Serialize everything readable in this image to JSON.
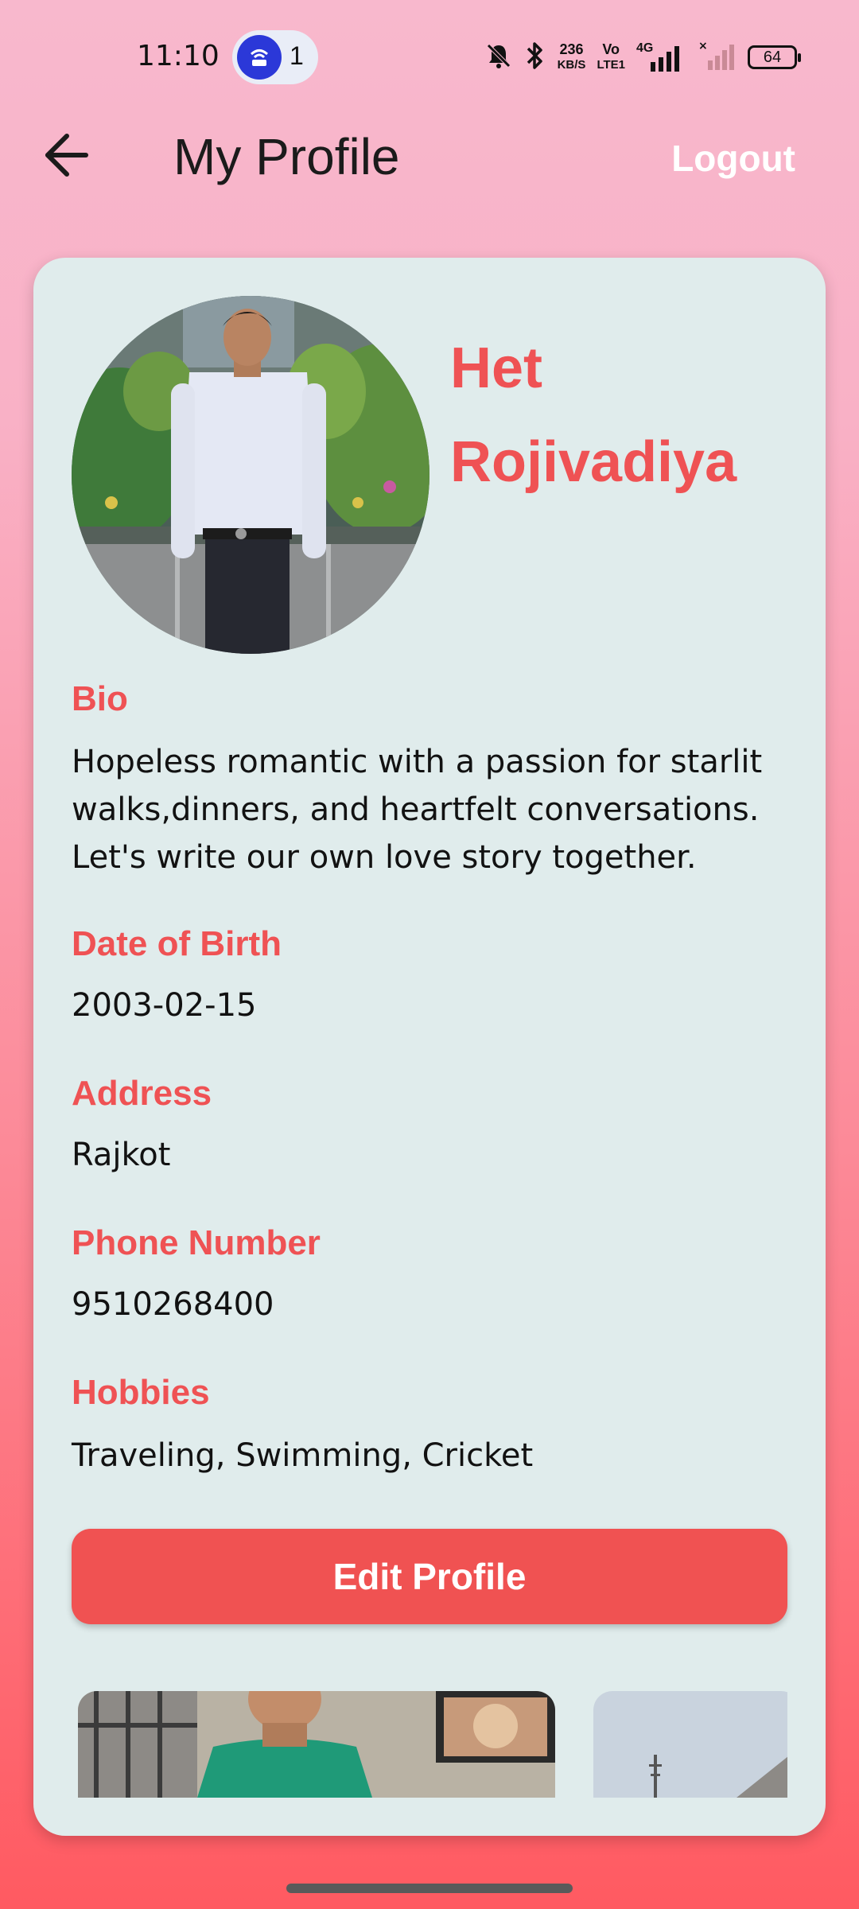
{
  "status_bar": {
    "time": "11:10",
    "hotspot_count": "1",
    "network_speed_value": "236",
    "network_speed_unit": "KB/S",
    "volte_top": "Vo",
    "volte_bottom": "LTE1",
    "network_type": "4G",
    "battery_level": "64",
    "icons": [
      "hotspot-icon",
      "silent-bell-icon",
      "bluetooth-icon",
      "signal-icon",
      "battery-icon"
    ]
  },
  "app_bar": {
    "title": "My Profile",
    "logout_label": "Logout"
  },
  "profile": {
    "name": "Het Rojivadiya",
    "bio_label": "Bio",
    "bio": "Hopeless romantic with a passion for starlit walks,dinners, and heartfelt conversations. Let's write our own love story together.",
    "dob_label": "Date of Birth",
    "dob": "2003-02-15",
    "address_label": "Address",
    "address": "Rajkot",
    "phone_label": "Phone Number",
    "phone": "9510268400",
    "hobbies_label": "Hobbies",
    "hobbies": "Traveling, Swimming, Cricket",
    "edit_label": "Edit Profile"
  },
  "colors": {
    "accent": "#ef5254",
    "button": "#f05252",
    "card": "#e0ecec",
    "gradient_top": "#f8b8cd",
    "gradient_bottom": "#ff5a61"
  }
}
